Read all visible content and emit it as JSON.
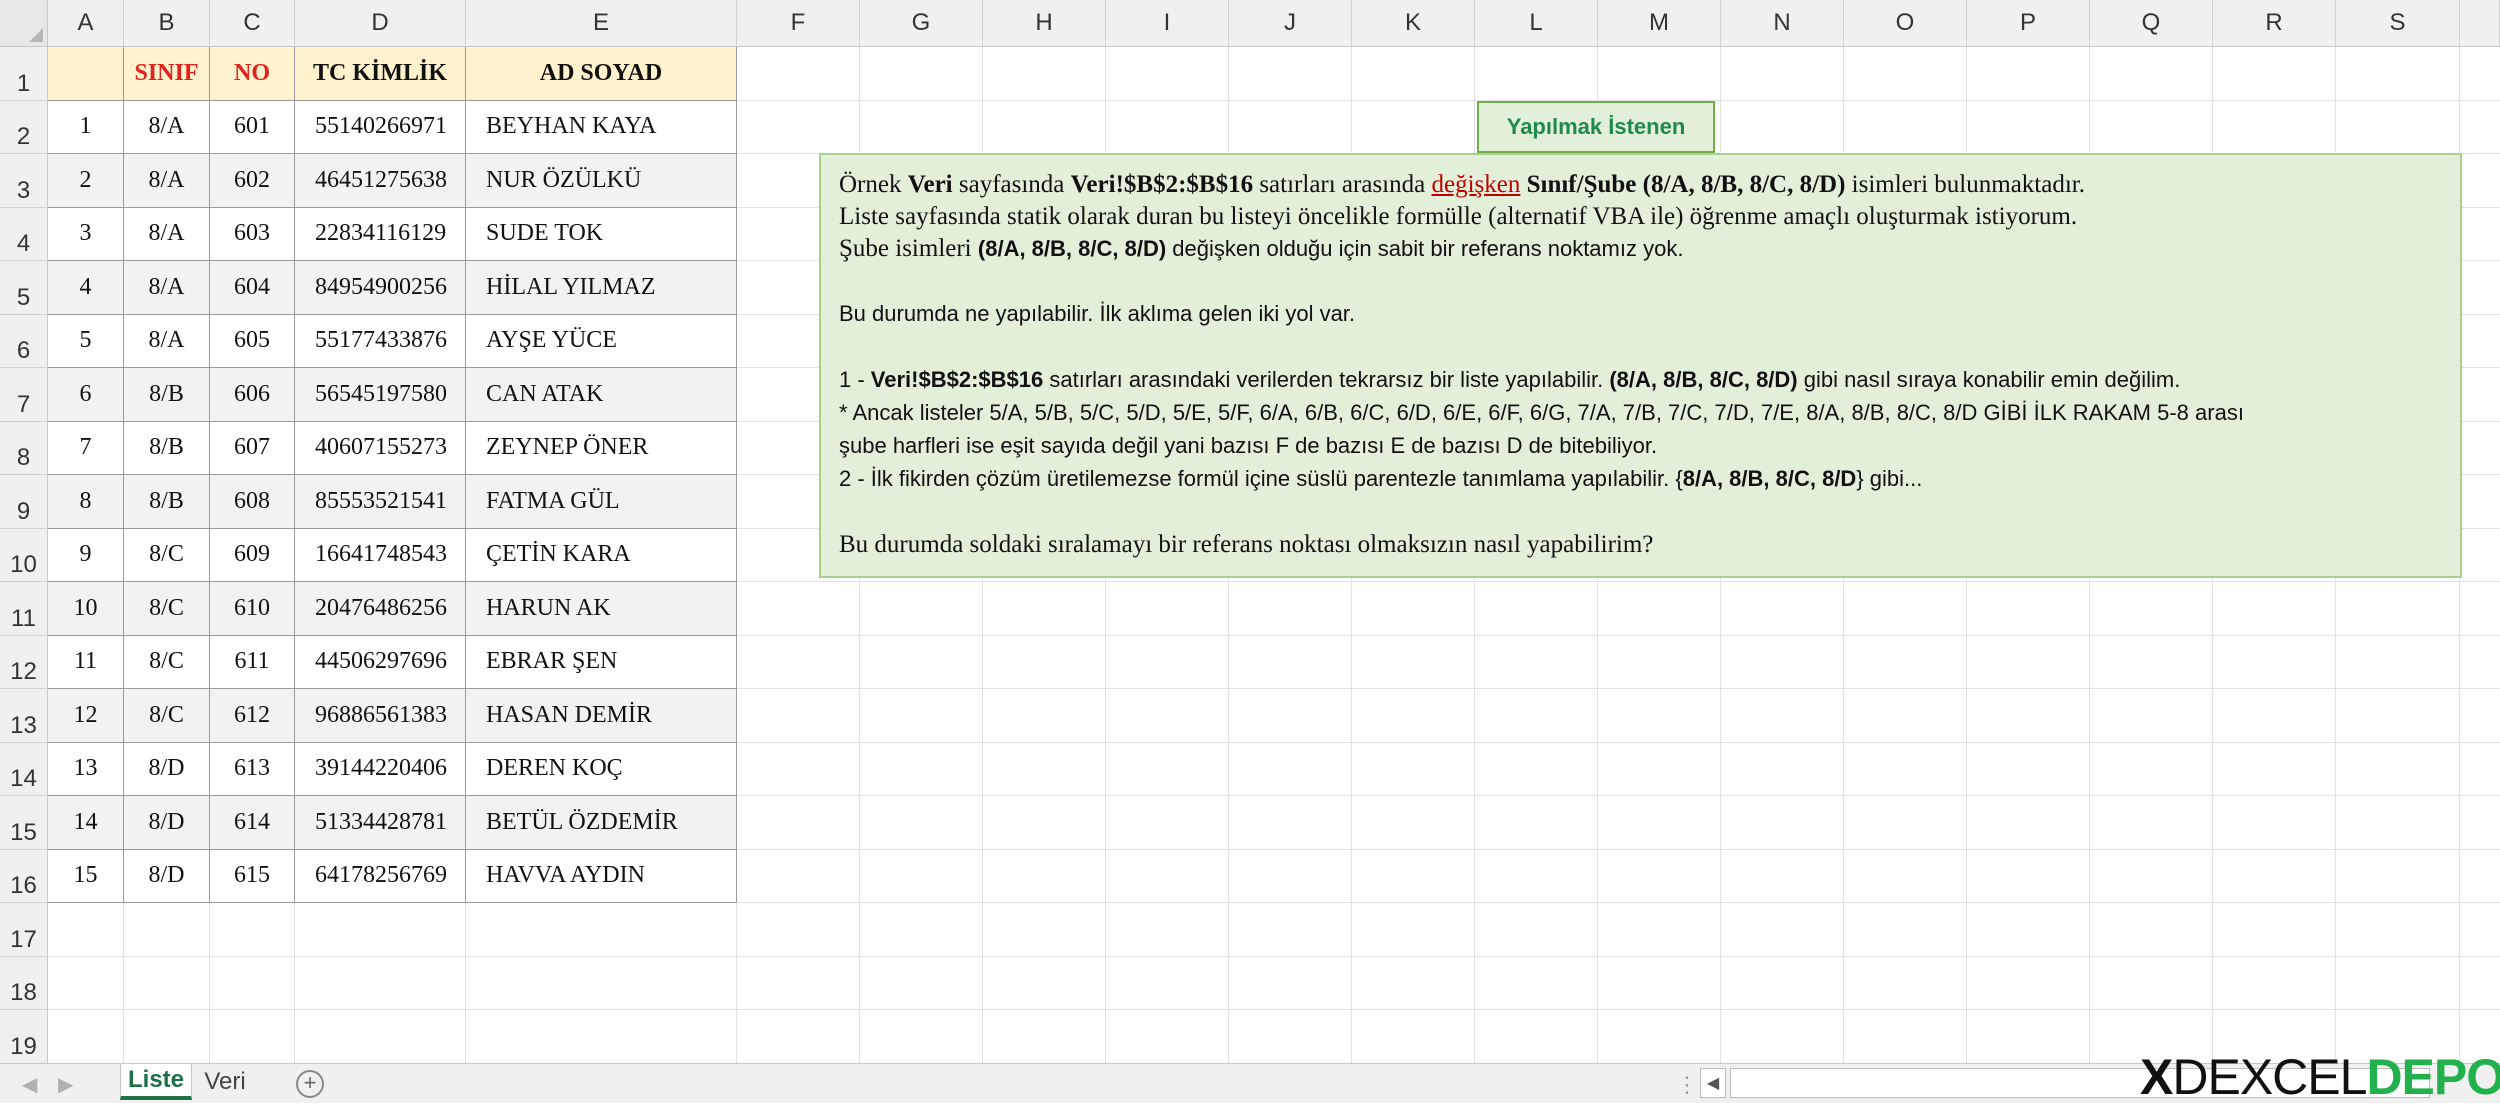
{
  "columns": [
    "A",
    "B",
    "C",
    "D",
    "E",
    "F",
    "G",
    "H",
    "I",
    "J",
    "K",
    "L",
    "M",
    "N",
    "O",
    "P",
    "Q",
    "R",
    "S"
  ],
  "rows": [
    "1",
    "2",
    "3",
    "4",
    "5",
    "6",
    "7",
    "8",
    "9",
    "10",
    "11",
    "12",
    "13",
    "14",
    "15",
    "16",
    "17",
    "18",
    "19"
  ],
  "table": {
    "headers": [
      "",
      "SINIF",
      "NO",
      "TC KİMLİK",
      "AD SOYAD"
    ],
    "rows": [
      [
        "1",
        "8/A",
        "601",
        "55140266971",
        "BEYHAN KAYA"
      ],
      [
        "2",
        "8/A",
        "602",
        "46451275638",
        "NUR ÖZÜLKÜ"
      ],
      [
        "3",
        "8/A",
        "603",
        "22834116129",
        "SUDE TOK"
      ],
      [
        "4",
        "8/A",
        "604",
        "84954900256",
        "HİLAL YILMAZ"
      ],
      [
        "5",
        "8/A",
        "605",
        "55177433876",
        "AYŞE YÜCE"
      ],
      [
        "6",
        "8/B",
        "606",
        "56545197580",
        "CAN ATAK"
      ],
      [
        "7",
        "8/B",
        "607",
        "40607155273",
        "ZEYNEP  ÖNER"
      ],
      [
        "8",
        "8/B",
        "608",
        "85553521541",
        "FATMA GÜL"
      ],
      [
        "9",
        "8/C",
        "609",
        "16641748543",
        "ÇETİN KARA"
      ],
      [
        "10",
        "8/C",
        "610",
        "20476486256",
        "HARUN AK"
      ],
      [
        "11",
        "8/C",
        "611",
        "44506297696",
        "EBRAR ŞEN"
      ],
      [
        "12",
        "8/C",
        "612",
        "96886561383",
        "HASAN DEMİR"
      ],
      [
        "13",
        "8/D",
        "613",
        "39144220406",
        "DEREN KOÇ"
      ],
      [
        "14",
        "8/D",
        "614",
        "51334428781",
        "BETÜL ÖZDEMİR"
      ],
      [
        "15",
        "8/D",
        "615",
        "64178256769",
        "HAVVA AYDIN"
      ]
    ]
  },
  "title_box": "Yapılmak İstenen",
  "note": {
    "l1": {
      "a": "Örnek ",
      "b": "Veri",
      "c": " sayfasında ",
      "d": "Veri!$B$2:$B$16",
      "e": " satırları arasında ",
      "f": "değişken",
      "g": " ",
      "h": "Sınıf/Şube (8/A, 8/B, 8/C, 8/D)",
      "i": " isimleri bulunmaktadır."
    },
    "l2": "Liste sayfasında statik olarak duran bu listeyi öncelikle formülle (alternatif VBA ile) öğrenme amaçlı oluşturmak istiyorum.",
    "l3": {
      "a": "Şube isimleri ",
      "b": "(8/A, 8/B, 8/C, 8/D)",
      "c": " değişken olduğu için sabit bir referans noktamız yok."
    },
    "l4": "Bu durumda ne yapılabilir. İlk aklıma gelen iki yol var.",
    "l5": {
      "a": "1 - ",
      "b": "Veri!$B$2:$B$16",
      "c": " satırları arasındaki verilerden tekrarsız bir liste yapılabilir. ",
      "d": "(8/A, 8/B, 8/C, 8/D)",
      "e": " gibi nasıl sıraya konabilir emin değilim."
    },
    "l6": "* Ancak listeler 5/A, 5/B, 5/C, 5/D, 5/E, 5/F, 6/A, 6/B, 6/C, 6/D, 6/E, 6/F, 6/G, 7/A, 7/B, 7/C, 7/D, 7/E, 8/A, 8/B, 8/C, 8/D GİBİ İLK RAKAM 5-8 arası",
    "l7": "şube harfleri ise eşit sayıda değil yani bazısı F de bazısı E de bazısı D de bitebiliyor.",
    "l8": {
      "a": "2 - İlk fikirden çözüm üretilemezse formül içine süslü parentezle tanımlama yapılabilir. {",
      "b": "8/A, 8/B, 8/C, 8/D",
      "c": "} gibi..."
    },
    "l9": "Bu durumda soldaki sıralamayı bir referans noktası olmaksızın nasıl yapabilirim?"
  },
  "tabs": {
    "active": "Liste",
    "other": "Veri",
    "add": "+"
  },
  "logo": {
    "x": "X",
    "excel": "DEXCEL",
    "depo": "DEPO"
  },
  "colors": {
    "header_fill": "#fff2cc",
    "header_red": "#e3211c",
    "note_fill": "#e2efd9",
    "note_border": "#a9d08e",
    "title_text": "#1f8a4c",
    "tab_active": "#1e7145"
  }
}
